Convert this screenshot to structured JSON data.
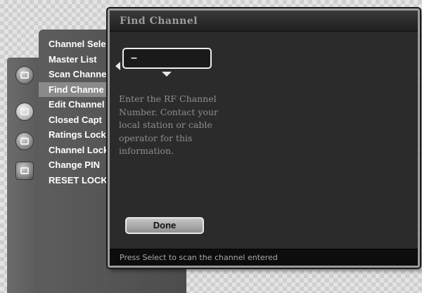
{
  "sidebar": {
    "icons": [
      "audio-icon",
      "display-icon",
      "channel-icon",
      "camera-icon"
    ]
  },
  "submenu": {
    "items": [
      {
        "label": "Channel Sele"
      },
      {
        "label": "Master List"
      },
      {
        "label": "Scan Channe"
      },
      {
        "label": "Find Channe"
      },
      {
        "label": "Edit Channel"
      },
      {
        "label": "Closed Capt"
      },
      {
        "label": "Ratings Lock"
      },
      {
        "label": "Channel Lock"
      },
      {
        "label": "Change PIN"
      },
      {
        "label": "RESET LOCKS"
      }
    ],
    "selected_index": 3
  },
  "dialog": {
    "title": "Find Channel",
    "input_value": "–",
    "instructions": "Enter the RF Channel Number. Contact your local station or cable operator for this information.",
    "done_label": "Done",
    "status": "Press Select to scan the channel entered"
  }
}
